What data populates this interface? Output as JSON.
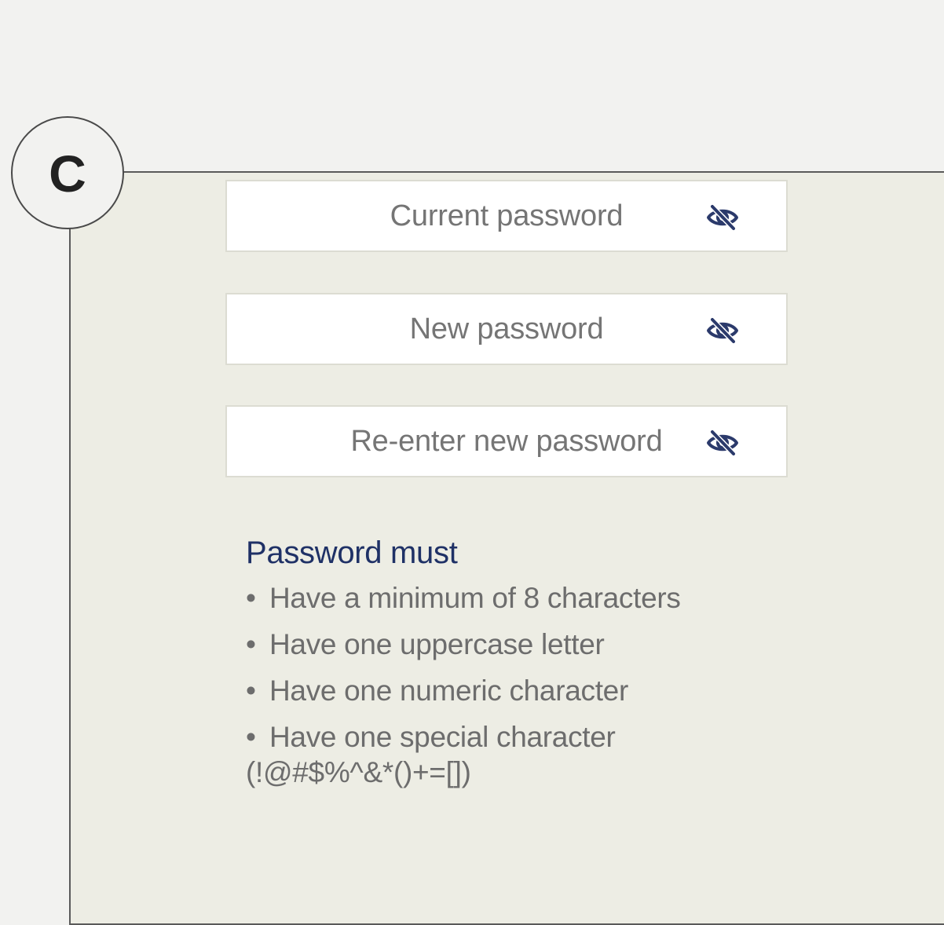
{
  "badge": {
    "letter": "C"
  },
  "fields": [
    {
      "placeholder": "Current password",
      "icon": "eye-slash-icon"
    },
    {
      "placeholder": "New password",
      "icon": "eye-slash-icon"
    },
    {
      "placeholder": "Re-enter new password",
      "icon": "eye-slash-icon"
    }
  ],
  "rules": {
    "title": "Password must",
    "bullet": "•",
    "items": [
      "Have a minimum of 8 characters",
      "Have one uppercase letter",
      "Have one numeric character",
      "Have one special character"
    ],
    "special_chars": "(!@#$%^&*()+=[])"
  },
  "colors": {
    "title": "#1f3166",
    "text": "#6d6d6d",
    "placeholder": "#757575",
    "icon": "#2b3a6b",
    "panel": "#edede4",
    "page": "#f2f2f0"
  }
}
